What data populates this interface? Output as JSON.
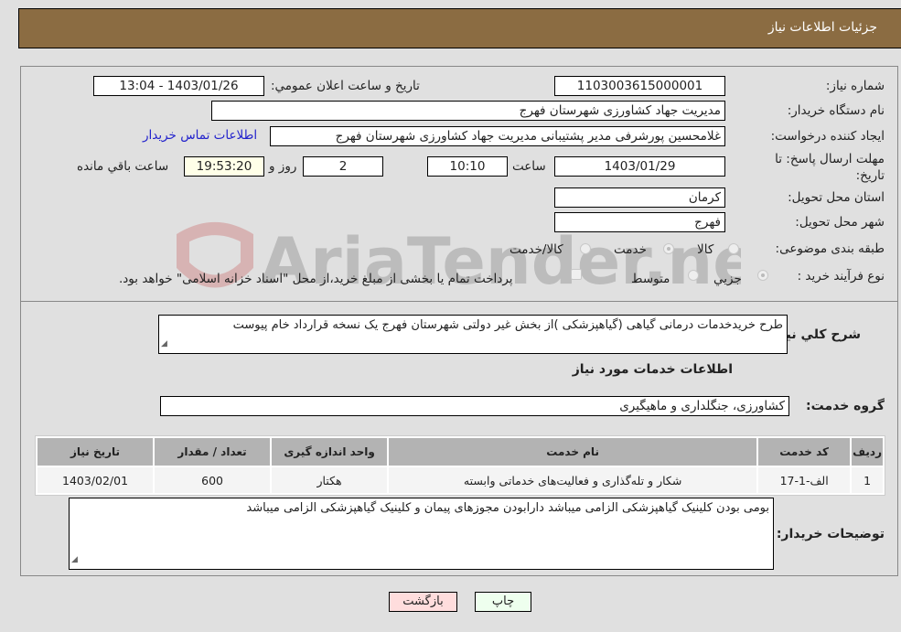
{
  "header": {
    "title": "جزئیات اطلاعات نیاز"
  },
  "form": {
    "need_number": {
      "label": "شماره نیاز:",
      "value": "1103003615000001"
    },
    "announce": {
      "label": "تاریخ و ساعت اعلان عمومي:",
      "value": "1403/01/26 - 13:04"
    },
    "buyer_org": {
      "label": "نام دستگاه خریدار:",
      "value": "مدیریت جهاد کشاورزی شهرستان فهرج"
    },
    "creator": {
      "label": "ایجاد کننده درخواست:",
      "value": "غلامحسین پورشرفی مدیر پشتیبانی مدیریت جهاد کشاورزی شهرستان فهرج",
      "contact_link": "اطلاعات تماس خریدار"
    },
    "deadline": {
      "label": "مهلت ارسال پاسخ: تا تاریخ:",
      "date": "1403/01/29",
      "time_label": "ساعت",
      "time": "10:10",
      "days": "2",
      "days_label": "روز و",
      "remaining": "19:53:20",
      "remaining_label": "ساعت باقي مانده"
    },
    "province": {
      "label": "استان محل تحویل:",
      "value": "کرمان"
    },
    "city": {
      "label": "شهر محل تحویل:",
      "value": "فهرج"
    },
    "category": {
      "label": "طبقه بندی موضوعی:",
      "options": [
        "کالا",
        "خدمت",
        "کالا/خدمت"
      ],
      "selected": "خدمت"
    },
    "process": {
      "label": "نوع فرآیند خرید :",
      "options": [
        "جزیي",
        "متوسط"
      ],
      "selected": "جزیي",
      "treasury_note": "پرداخت تمام یا بخشی از مبلغ خرید،از محل \"اسناد خزانه اسلامی\" خواهد بود."
    }
  },
  "description": {
    "label": "شرح کلي نیاز:",
    "value": "طرح خریدخدمات درمانی گیاهی (گیاهپزشکی )از بخش غیر دولتی شهرستان فهرج یک نسخه قرارداد خام پیوست"
  },
  "services_section": {
    "title": "اطلاعات خدمات مورد نیاز",
    "group_label": "گروه خدمت:",
    "group_value": "کشاورزی، جنگلداری و ماهیگیری"
  },
  "table": {
    "headers": [
      "ردیف",
      "کد خدمت",
      "نام خدمت",
      "واحد اندازه گیری",
      "تعداد / مقدار",
      "تاریخ نیاز"
    ],
    "rows": [
      [
        "1",
        "الف-1-17",
        "شکار و تله‌گذاری و فعالیت‌های خدماتی وابسته",
        "هکتار",
        "600",
        "1403/02/01"
      ]
    ]
  },
  "buyer_notes": {
    "label": "توضیحات خریدار:",
    "value": "بومی بودن کلینیک گیاهپزشکی الزامی میباشد دارابودن مجوزهای پیمان و کلینیک گیاهپزشکی الزامی میباشد"
  },
  "buttons": {
    "print": "چاپ",
    "back": "بازگشت"
  },
  "watermark": {
    "text": "AriaTender.neT"
  },
  "colors": {
    "header_bg": "#8b6c42",
    "print_bg": "#eeffee",
    "back_bg": "#ffdddd",
    "link": "#2222cc"
  }
}
